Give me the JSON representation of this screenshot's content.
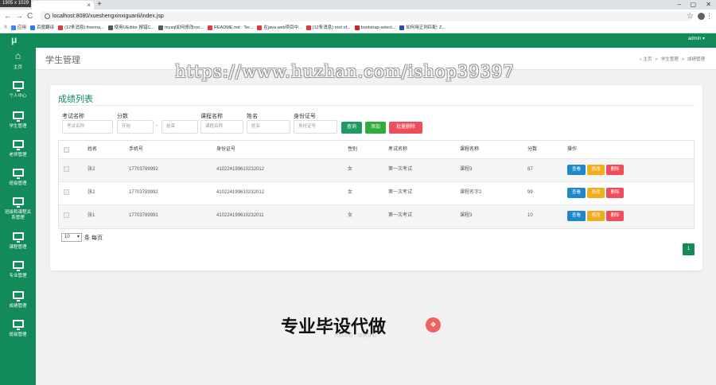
{
  "browser": {
    "resolution_badge": "1905 x 1029",
    "tab_close": "×",
    "new_tab": "+",
    "win_min": "–",
    "win_max": "▢",
    "win_close": "✕",
    "back": "←",
    "forward": "→",
    "reload": "C",
    "url": "localhost:8080/xueshengxinxiguanli/index.jsp",
    "bookmarks": [
      {
        "label": "应用",
        "color": "#4285f4"
      },
      {
        "label": "百度翻译",
        "color": "#2d7be0"
      },
      {
        "label": "(12条消息) freema...",
        "color": "#e53935"
      },
      {
        "label": "使用UEditor 报错C...",
        "color": "#555555"
      },
      {
        "label": "mysql如何修改roo...",
        "color": "#555555"
      },
      {
        "label": "README.md · Ter...",
        "color": "#e53935"
      },
      {
        "label": "在java web项目中...",
        "color": "#e53935"
      },
      {
        "label": "(12条消息) root of...",
        "color": "#e53935"
      },
      {
        "label": "bootstrap-select...",
        "color": "#c62828"
      },
      {
        "label": "如何用正则匹配: Z...",
        "color": "#3949ab"
      }
    ]
  },
  "app": {
    "logo": "μ",
    "user": "admin ▾",
    "page_title": "学生管理",
    "breadcrumb": [
      "⌂ 主页",
      ">",
      "学生管理",
      ">",
      "成绩管理"
    ]
  },
  "sidebar": [
    {
      "label": "主页",
      "icon": "home"
    },
    {
      "label": "个人中心",
      "icon": "monitor"
    },
    {
      "label": "学生管理",
      "icon": "monitor"
    },
    {
      "label": "老师管理",
      "icon": "monitor"
    },
    {
      "label": "班级管理",
      "icon": "monitor"
    },
    {
      "label": "班级和课程关系管理",
      "icon": "monitor"
    },
    {
      "label": "课程管理",
      "icon": "monitor"
    },
    {
      "label": "专业管理",
      "icon": "monitor"
    },
    {
      "label": "成绩管理",
      "icon": "monitor"
    },
    {
      "label": "班级管理",
      "icon": "monitor"
    }
  ],
  "watermark": "https://www.huzhan.com/ishop39397",
  "card": {
    "title": "成绩列表",
    "filters": {
      "exam_label": "考试名称",
      "exam_placeholder": "考试名称",
      "score_label": "分数",
      "score_start_placeholder": "开始",
      "score_dash": "-",
      "score_end_placeholder": "结束",
      "course_label": "课程名称",
      "course_placeholder": "课程名称",
      "name_label": "姓名",
      "name_placeholder": "姓名",
      "idcard_label": "身份证号",
      "idcard_placeholder": "身份证号"
    },
    "buttons": {
      "search": "查询",
      "add": "添加",
      "batch_delete": "批量删除"
    },
    "columns": [
      "姓名",
      "手机号",
      "身份证号",
      "性别",
      "考试名称",
      "课程名称",
      "分数",
      "操作"
    ],
    "rows": [
      {
        "name": "张2",
        "phone": "17703789992",
        "idcard": "410224199610232012",
        "gender": "女",
        "exam": "第一次考试",
        "course": "课程3",
        "score": "87"
      },
      {
        "name": "张2",
        "phone": "17703789992",
        "idcard": "410224199610232012",
        "gender": "女",
        "exam": "第一次考试",
        "course": "课程名字2",
        "score": "99"
      },
      {
        "name": "张1",
        "phone": "17703789991",
        "idcard": "410224199610232011",
        "gender": "女",
        "exam": "第一次考试",
        "course": "课程3",
        "score": "10"
      }
    ],
    "actions": {
      "view": "查看",
      "edit": "修改",
      "delete": "删除"
    },
    "page_size": "10",
    "page_size_suffix": "条 每页",
    "current_page": "1"
  },
  "float_button_icon": "❖",
  "promo": "专业毕设代做",
  "promo_sub": "代码毕设 · 源码获取",
  "colors": {
    "primary": "#128a5a",
    "view": "#1e88c8",
    "edit": "#f0ad1e",
    "delete": "#ee4d5a",
    "search": "#1f9a63",
    "add": "#30ac3c",
    "batch_delete": "#ef4d5a"
  }
}
